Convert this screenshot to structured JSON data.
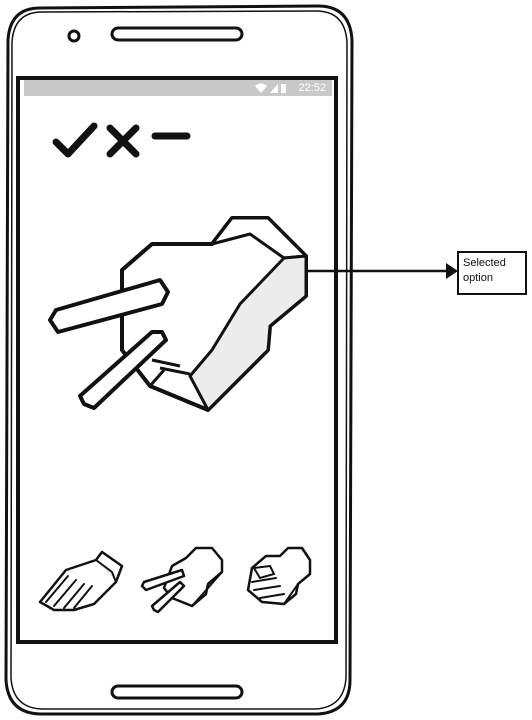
{
  "statusbar": {
    "time": "22:52"
  },
  "score_icons": [
    "check-icon",
    "cross-icon",
    "minus-icon"
  ],
  "main": {
    "selected_hand": "scissors-hand-icon"
  },
  "options": [
    {
      "name": "paper",
      "icon": "paper-hand-icon"
    },
    {
      "name": "scissors",
      "icon": "scissors-hand-icon"
    },
    {
      "name": "rock",
      "icon": "rock-hand-icon"
    }
  ],
  "annotation": {
    "line1": "Selected",
    "line2": "option"
  }
}
